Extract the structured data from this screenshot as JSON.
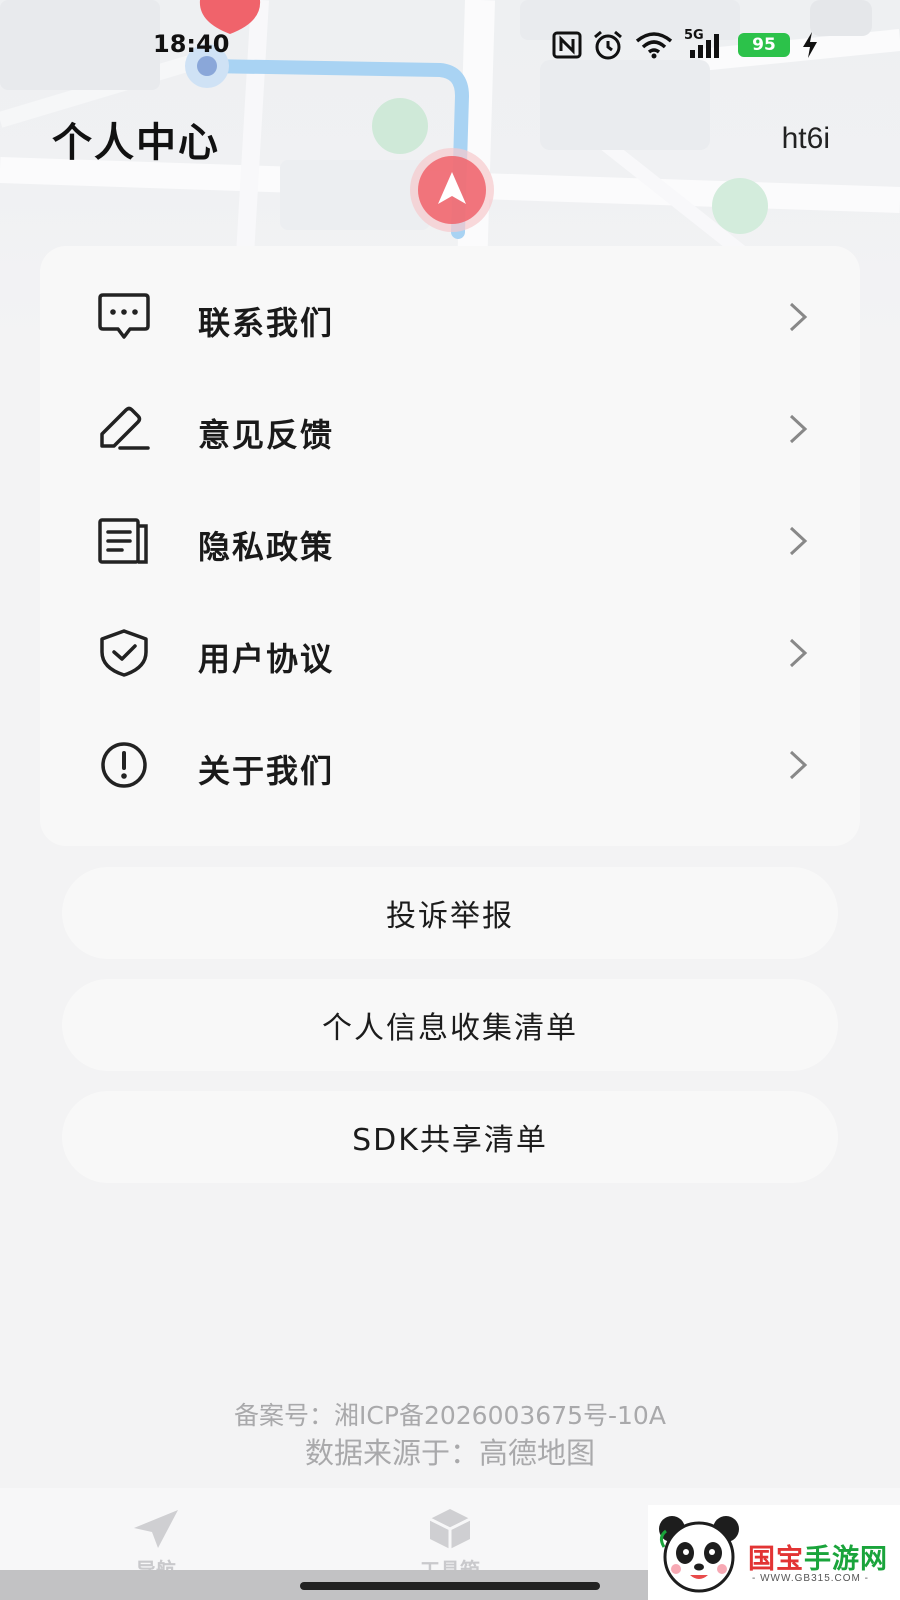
{
  "status_bar": {
    "time": "18:40",
    "battery": "95",
    "network": "5G",
    "icons": [
      "nfc-icon",
      "alarm-icon",
      "wifi-icon",
      "signal-icon",
      "battery-icon",
      "charging-icon"
    ]
  },
  "header": {
    "title": "个人中心",
    "username": "ht6i"
  },
  "menu": {
    "items": [
      {
        "label": "联系我们",
        "icon": "chat-bubble-icon"
      },
      {
        "label": "意见反馈",
        "icon": "edit-pen-icon"
      },
      {
        "label": "隐私政策",
        "icon": "document-icon"
      },
      {
        "label": "用户协议",
        "icon": "shield-check-icon"
      },
      {
        "label": "关于我们",
        "icon": "info-exclamation-icon"
      }
    ]
  },
  "buttons": {
    "report": "投诉举报",
    "personal_info_list": "个人信息收集清单",
    "sdk_list": "SDK共享清单"
  },
  "footer": {
    "icp": "备案号：湘ICP备2026003675号-10A",
    "data_source": "数据来源于：高德地图"
  },
  "tabs": [
    {
      "label": "导航",
      "icon": "navigation-arrow-icon"
    },
    {
      "label": "工具箱",
      "icon": "toolbox-cube-icon"
    }
  ],
  "watermark": {
    "name_red": "国宝",
    "name_green": "手游网",
    "url": "- WWW.GB315.COM -"
  },
  "colors": {
    "background": "#f3f3f4",
    "card": "#f8f8f8",
    "battery": "#2cc24a",
    "map_route": "#a9d3f3",
    "map_pin": "#f0636b",
    "watermark_green": "#1aa43b",
    "watermark_red": "#e23434"
  }
}
